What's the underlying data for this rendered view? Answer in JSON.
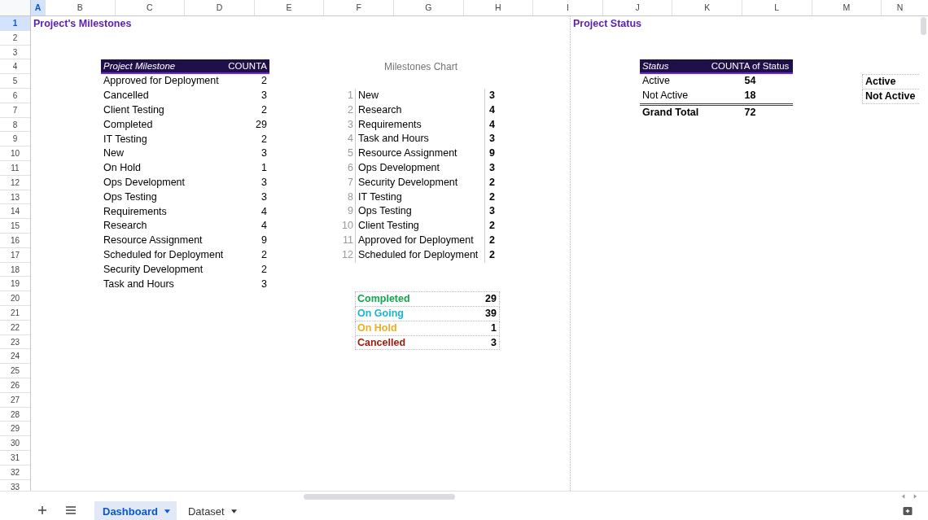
{
  "column_headers": [
    {
      "label": "A",
      "selected": true
    },
    {
      "label": "B",
      "selected": false
    },
    {
      "label": "C",
      "selected": false
    },
    {
      "label": "D",
      "selected": false
    },
    {
      "label": "E",
      "selected": false
    },
    {
      "label": "F",
      "selected": false
    },
    {
      "label": "G",
      "selected": false
    },
    {
      "label": "H",
      "selected": false
    },
    {
      "label": "I",
      "selected": false
    },
    {
      "label": "J",
      "selected": false
    },
    {
      "label": "K",
      "selected": false
    },
    {
      "label": "L",
      "selected": false
    },
    {
      "label": "M",
      "selected": false
    },
    {
      "label": "N",
      "selected": false
    }
  ],
  "row_headers": [
    {
      "label": "1",
      "selected": true
    },
    {
      "label": "2",
      "selected": false
    },
    {
      "label": "3",
      "selected": false
    },
    {
      "label": "4",
      "selected": false
    },
    {
      "label": "5",
      "selected": false
    },
    {
      "label": "6",
      "selected": false
    },
    {
      "label": "7",
      "selected": false
    },
    {
      "label": "8",
      "selected": false
    },
    {
      "label": "9",
      "selected": false
    },
    {
      "label": "10",
      "selected": false
    },
    {
      "label": "11",
      "selected": false
    },
    {
      "label": "12",
      "selected": false
    },
    {
      "label": "13",
      "selected": false
    },
    {
      "label": "14",
      "selected": false
    },
    {
      "label": "15",
      "selected": false
    },
    {
      "label": "16",
      "selected": false
    },
    {
      "label": "17",
      "selected": false
    },
    {
      "label": "18",
      "selected": false
    },
    {
      "label": "19",
      "selected": false
    },
    {
      "label": "20",
      "selected": false
    },
    {
      "label": "21",
      "selected": false
    },
    {
      "label": "22",
      "selected": false
    },
    {
      "label": "23",
      "selected": false
    },
    {
      "label": "24",
      "selected": false
    },
    {
      "label": "25",
      "selected": false
    },
    {
      "label": "26",
      "selected": false
    },
    {
      "label": "27",
      "selected": false
    },
    {
      "label": "28",
      "selected": false
    },
    {
      "label": "29",
      "selected": false
    },
    {
      "label": "30",
      "selected": false
    },
    {
      "label": "31",
      "selected": false
    },
    {
      "label": "32",
      "selected": false
    },
    {
      "label": "33",
      "selected": false
    }
  ],
  "milestones": {
    "title": "Project's Milestones",
    "pivot": {
      "columns": [
        "Project Milestone",
        "COUNTA"
      ],
      "rows": [
        [
          "Approved for Deployment",
          "2"
        ],
        [
          "Cancelled",
          "3"
        ],
        [
          "Client Testing",
          "2"
        ],
        [
          "Completed",
          "29"
        ],
        [
          "IT Testing",
          "2"
        ],
        [
          "New",
          "3"
        ],
        [
          "On Hold",
          "1"
        ],
        [
          "Ops Development",
          "3"
        ],
        [
          "Ops Testing",
          "3"
        ],
        [
          "Requirements",
          "4"
        ],
        [
          "Research",
          "4"
        ],
        [
          "Resource Assignment",
          "9"
        ],
        [
          "Scheduled for Deployment",
          "2"
        ],
        [
          "Security Development",
          "2"
        ],
        [
          "Task and Hours",
          "3"
        ]
      ]
    },
    "chart": {
      "title": "Milestones Chart",
      "rows": [
        {
          "rank": "1",
          "label": "New",
          "value": "3"
        },
        {
          "rank": "2",
          "label": "Research",
          "value": "4"
        },
        {
          "rank": "3",
          "label": "Requirements",
          "value": "4"
        },
        {
          "rank": "4",
          "label": "Task and Hours",
          "value": "3"
        },
        {
          "rank": "5",
          "label": "Resource Assignment",
          "value": "9"
        },
        {
          "rank": "6",
          "label": "Ops Development",
          "value": "3"
        },
        {
          "rank": "7",
          "label": "Security Development",
          "value": "2"
        },
        {
          "rank": "8",
          "label": "IT Testing",
          "value": "2"
        },
        {
          "rank": "9",
          "label": "Ops Testing",
          "value": "3"
        },
        {
          "rank": "10",
          "label": "Client Testing",
          "value": "2"
        },
        {
          "rank": "11",
          "label": "Approved for Deployment",
          "value": "2"
        },
        {
          "rank": "12",
          "label": "Scheduled for Deployment",
          "value": "2"
        }
      ]
    },
    "status_summary": [
      {
        "label": "Completed",
        "value": "29",
        "color": "#14a550"
      },
      {
        "label": "On Going",
        "value": "39",
        "color": "#18b6d6"
      },
      {
        "label": "On Hold",
        "value": "1",
        "color": "#e8b123"
      },
      {
        "label": "Cancelled",
        "value": "3",
        "color": "#a61c0a"
      }
    ]
  },
  "project_status": {
    "title": "Project Status",
    "pivot": {
      "columns": [
        "Status",
        "COUNTA of Status"
      ],
      "rows": [
        [
          "Active",
          "54"
        ],
        [
          "Not Active",
          "18"
        ]
      ],
      "total": [
        "Grand Total",
        "72"
      ]
    },
    "legend": [
      "Active",
      "Not Active"
    ]
  },
  "sheet_tabs": [
    {
      "label": "Dashboard",
      "selected": true
    },
    {
      "label": "Dataset",
      "selected": false
    }
  ]
}
